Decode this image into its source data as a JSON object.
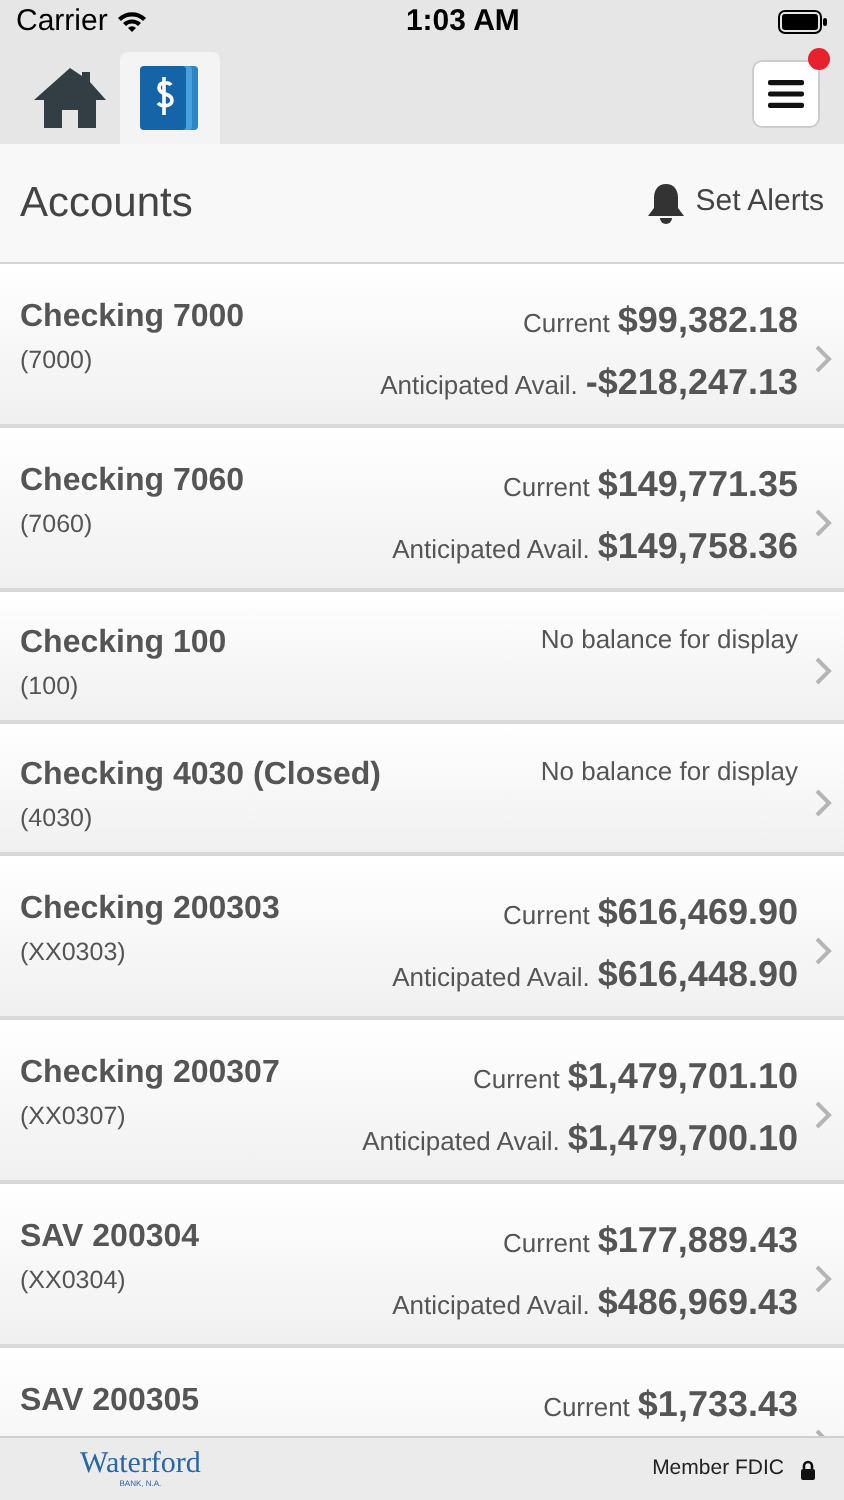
{
  "status_bar": {
    "carrier": "Carrier",
    "time": "1:03 AM"
  },
  "tabs": [
    {
      "selected": false
    },
    {
      "selected": true
    }
  ],
  "menu_button": {
    "notification": true
  },
  "header": {
    "title": "Accounts",
    "action": "Set Alerts"
  },
  "accounts": [
    {
      "kind": "balances",
      "name": "Checking 7000",
      "number": "(7000)",
      "balances": [
        {
          "label": "Current",
          "amount": "$99,382.18"
        },
        {
          "label": "Anticipated Avail.",
          "amount": "-$218,247.13"
        }
      ]
    },
    {
      "kind": "balances",
      "name": "Checking 7060",
      "number": "(7060)",
      "balances": [
        {
          "label": "Current",
          "amount": "$149,771.35"
        },
        {
          "label": "Anticipated Avail.",
          "amount": "$149,758.36"
        }
      ]
    },
    {
      "kind": "none",
      "name": "Checking 100",
      "number": "(100)",
      "note": "No balance for display"
    },
    {
      "kind": "none",
      "name": "Checking 4030 (Closed)",
      "number": "(4030)",
      "note": "No balance for display"
    },
    {
      "kind": "balances",
      "name": "Checking 200303",
      "number": "(XX0303)",
      "balances": [
        {
          "label": "Current",
          "amount": "$616,469.90"
        },
        {
          "label": "Anticipated Avail.",
          "amount": "$616,448.90"
        }
      ]
    },
    {
      "kind": "balances",
      "name": "Checking 200307",
      "number": "(XX0307)",
      "balances": [
        {
          "label": "Current",
          "amount": "$1,479,701.10"
        },
        {
          "label": "Anticipated Avail.",
          "amount": "$1,479,700.10"
        }
      ]
    },
    {
      "kind": "balances",
      "name": "SAV 200304",
      "number": "(XX0304)",
      "balances": [
        {
          "label": "Current",
          "amount": "$177,889.43"
        },
        {
          "label": "Anticipated Avail.",
          "amount": "$486,969.43"
        }
      ]
    },
    {
      "kind": "balances",
      "name": "SAV 200305",
      "balances": [
        {
          "label": "Current",
          "amount": "$1,733.43"
        }
      ]
    }
  ],
  "footer": {
    "logo": "Waterford",
    "logo_sub": "BANK, N.A.",
    "fdic": "Member FDIC"
  }
}
